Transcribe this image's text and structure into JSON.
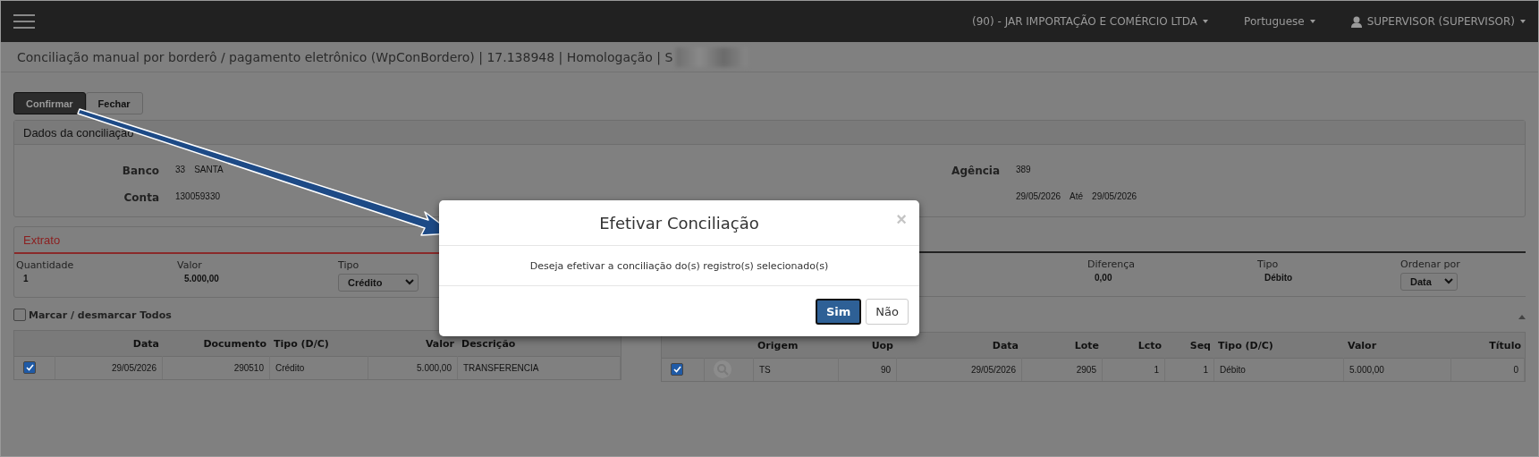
{
  "top_bar": {
    "company": "(90) - JAR IMPORTAÇÃO E COMÉRCIO LTDA",
    "language": "Portuguese",
    "user": "SUPERVISOR (SUPERVISOR)"
  },
  "page_title": "Conciliação manual por borderô / pagamento eletrônico (WpConBordero) | 17.138948 | Homologação | S",
  "toolbar": [
    {
      "label": "Confirmar",
      "selected": true
    },
    {
      "label": "Fechar",
      "selected": false
    }
  ],
  "dados": {
    "title": "Dados da conciliação",
    "fields": [
      {
        "label": "Banco",
        "values": [
          "33",
          "SANTA"
        ]
      },
      {
        "label": "Agência",
        "values": [
          "389"
        ]
      },
      {
        "label": "Conta",
        "values": [
          "130059330"
        ]
      },
      {
        "values": [
          "29/05/2026",
          "Até",
          "29/05/2026"
        ]
      }
    ]
  },
  "extrato": {
    "tab": "Extrato",
    "summary": [
      {
        "label": "Quantidade",
        "value": "1",
        "kind": "text"
      },
      {
        "label": "Valor",
        "value": "5.000,00",
        "kind": "text"
      },
      {
        "label": "Tipo",
        "value": "Crédito",
        "kind": "select"
      }
    ],
    "select_all": {
      "label": "Marcar / desmarcar Todos",
      "checked": false
    },
    "columns": [
      "Data",
      "Documento",
      "Tipo (D/C)",
      "Valor",
      "Descrição"
    ],
    "rows": [
      {
        "checked": true,
        "cells": [
          "29/05/2026",
          "290510",
          "Crédito",
          "5.000,00",
          "TRANSFERENCIA"
        ]
      }
    ]
  },
  "lancamentos": {
    "summary": [
      {
        "label": "Diferença",
        "value": "0,00",
        "kind": "text"
      },
      {
        "label": "Tipo",
        "value": "Débito",
        "kind": "text"
      },
      {
        "label": "Ordenar por",
        "value": "Data",
        "kind": "select"
      }
    ],
    "columns": [
      "Origem",
      "Uop",
      "Data",
      "Lote",
      "Lcto",
      "Seq",
      "Tipo (D/C)",
      "Valor",
      "Título"
    ],
    "rows": [
      {
        "checked": true,
        "cells": [
          "TS",
          "90",
          "29/05/2026",
          "2905",
          "1",
          "1",
          "Débito",
          "5.000,00",
          "0"
        ]
      }
    ]
  },
  "dialog": {
    "title": "Efetivar Conciliação",
    "close": "×",
    "message": "Deseja efetivar a conciliação do(s) registro(s) selecionado(s)",
    "buttons": [
      {
        "label": "Sim",
        "selected": true
      },
      {
        "label": "Não",
        "selected": false
      }
    ]
  }
}
